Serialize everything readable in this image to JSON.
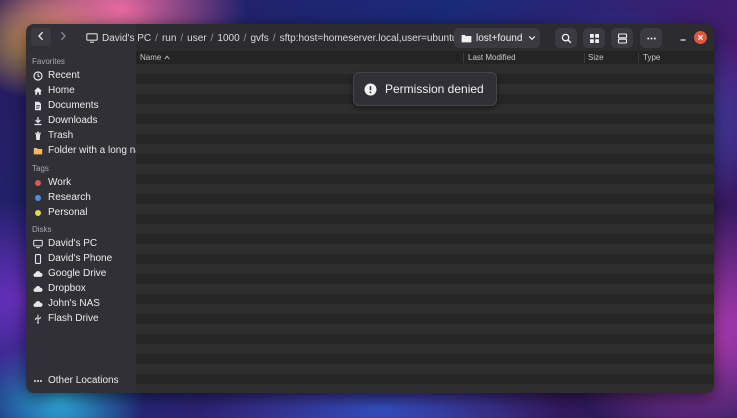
{
  "sidebar": {
    "favorites_label": "Favorites",
    "favorites": [
      {
        "label": "Recent",
        "icon": "clock-icon"
      },
      {
        "label": "Home",
        "icon": "home-icon"
      },
      {
        "label": "Documents",
        "icon": "document-icon"
      },
      {
        "label": "Downloads",
        "icon": "download-icon"
      },
      {
        "label": "Trash",
        "icon": "trash-icon"
      },
      {
        "label": "Folder with a long na",
        "icon": "folder-icon"
      }
    ],
    "tags_label": "Tags",
    "tags": [
      {
        "label": "Work",
        "color": "#e05555"
      },
      {
        "label": "Research",
        "color": "#4a90e2"
      },
      {
        "label": "Personal",
        "color": "#e6d84a"
      }
    ],
    "disks_label": "Disks",
    "disks": [
      {
        "label": "David's PC",
        "icon": "computer-icon"
      },
      {
        "label": "David's Phone",
        "icon": "phone-icon"
      },
      {
        "label": "Google Drive",
        "icon": "cloud-icon"
      },
      {
        "label": "Dropbox",
        "icon": "cloud-icon"
      },
      {
        "label": "John's NAS",
        "icon": "cloud-icon"
      },
      {
        "label": "Flash Drive",
        "icon": "usb-icon"
      }
    ],
    "other_locations": "Other Locations"
  },
  "breadcrumb": {
    "root": "David's PC",
    "parts": [
      "run",
      "user",
      "1000",
      "gvfs",
      "sftp:host=homeserver.local,user=ubuntu"
    ],
    "current": "lost+found"
  },
  "columns": {
    "name": "Name",
    "modified": "Last Modified",
    "size": "Size",
    "type": "Type"
  },
  "toast": {
    "message": "Permission denied"
  }
}
